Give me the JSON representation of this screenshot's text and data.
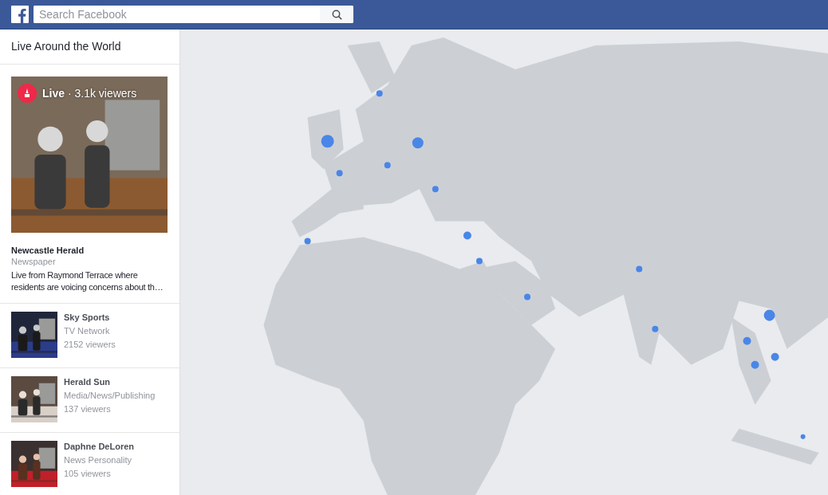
{
  "header": {
    "search": {
      "placeholder": "Search Facebook"
    }
  },
  "sidebar": {
    "title": "Live Around the World",
    "featured": {
      "badge": "**Live** · 3.1k viewers",
      "name": "Newcastle Herald",
      "category": "Newspaper",
      "description": "Live from Raymond Terrace where residents are voicing concerns about th…"
    },
    "items": [
      {
        "name": "Sky Sports",
        "category": "TV Network",
        "viewers": "2152 viewers"
      },
      {
        "name": "Herald Sun",
        "category": "Media/News/Publishing",
        "viewers": "137 viewers"
      },
      {
        "name": "Daphne DeLoren",
        "category": "News Personality",
        "viewers": "105 viewers"
      }
    ]
  }
}
